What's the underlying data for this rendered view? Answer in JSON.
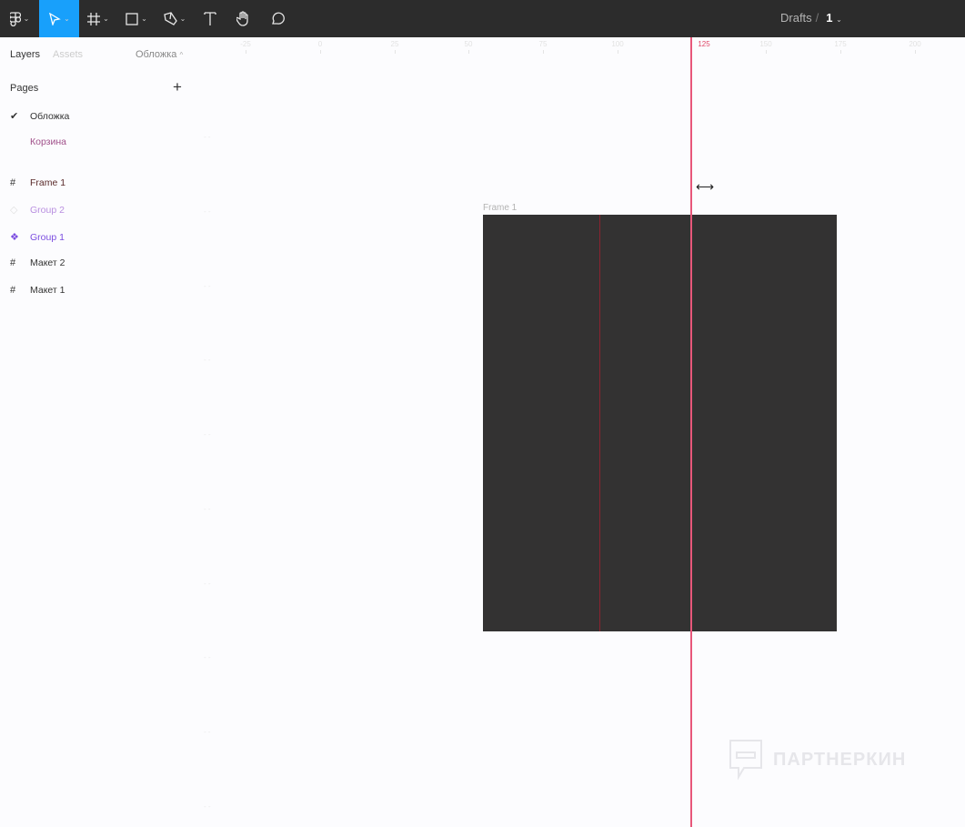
{
  "toolbar": {
    "tools": [
      "main-menu",
      "move",
      "frame",
      "shape",
      "pen",
      "text",
      "hand",
      "comment"
    ]
  },
  "breadcrumb": {
    "folder": "Drafts",
    "separator": "/",
    "file": "1"
  },
  "sidebar": {
    "tab_layers": "Layers",
    "tab_assets": "Assets",
    "current_page": "Обложка",
    "pages_label": "Pages",
    "pages": [
      {
        "label": "Обложка",
        "color": "#333333"
      },
      {
        "label": "Корзина",
        "color": "#a0508a"
      }
    ],
    "layers": [
      {
        "label": "Frame 1",
        "icon": "frame-icon",
        "color": "#5a2a2a"
      },
      {
        "label": "Group 2",
        "icon": "component-outline-icon",
        "color": "#b98fe0"
      },
      {
        "label": "Group 1",
        "icon": "component-icon",
        "color": "#7b4de0"
      },
      {
        "label": "Макет 2",
        "icon": "frame-icon",
        "color": "#333333"
      },
      {
        "label": "Макет 1",
        "icon": "frame-icon",
        "color": "#333333"
      }
    ]
  },
  "ruler": {
    "labels": [
      "-25",
      "0",
      "25",
      "50",
      "75",
      "100",
      "125",
      "150",
      "175",
      "200"
    ],
    "highlight": "125"
  },
  "canvas": {
    "frame_label": "Frame 1"
  },
  "watermark": "ПАРТНЕРКИН"
}
